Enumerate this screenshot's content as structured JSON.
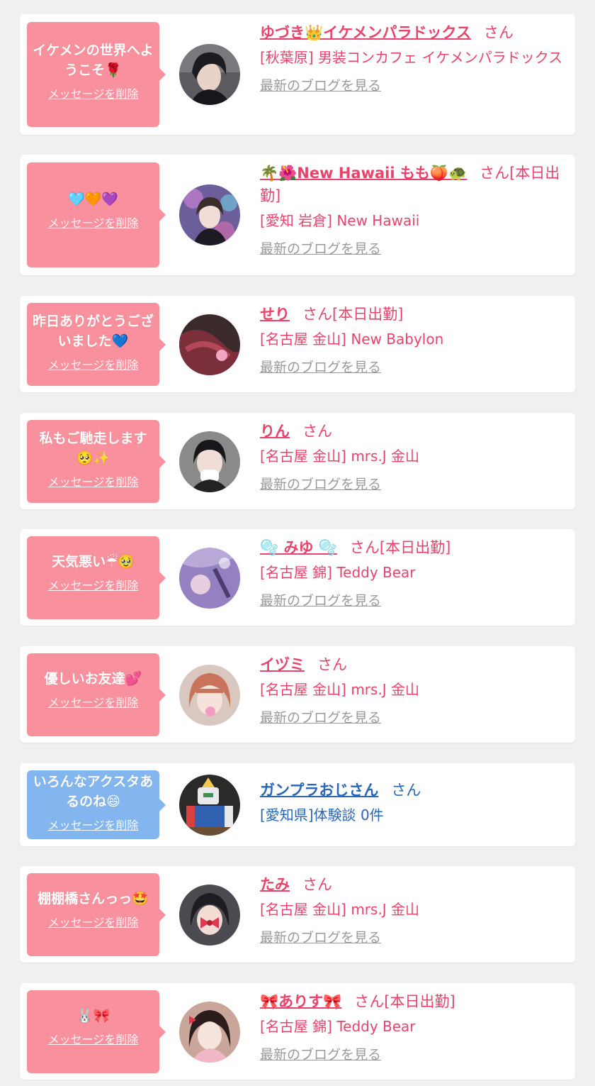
{
  "delete_label": "メッセージを削除",
  "blog_label": "最新のブログを見る",
  "colors": {
    "bubble_pink": "#f8909d",
    "bubble_blue": "#83b5ee",
    "name_pink": "#e8446b",
    "name_blue": "#2a66b8",
    "link_gray": "#9a9a9a"
  },
  "items": [
    {
      "message": "イケメンの世界へようこそ🌹",
      "name": "ゆづき👑イケメンパラドックス",
      "suffix": "さん",
      "shop": "[秋葉原] 男装コンカフェ イケメンパラドックス",
      "avatar": "dark-hair-portrait"
    },
    {
      "message": "🩵🧡💜",
      "name": "🌴🌺New Hawaii もも🍑🐢",
      "suffix": "さん[本日出勤]",
      "shop": "[愛知 岩倉] New Hawaii",
      "avatar": "neon-bg-portrait"
    },
    {
      "message": "昨日ありがとうございました💙",
      "name": "せり",
      "suffix": "さん[本日出勤]",
      "shop": "[名古屋 金山] New Babylon",
      "avatar": "red-hair-portrait"
    },
    {
      "message": "私もご馳走します🥺✨",
      "name": "りん",
      "suffix": "さん",
      "shop": "[名古屋 金山] mrs.J 金山",
      "avatar": "masked-portrait"
    },
    {
      "message": "天気悪い☔🥹",
      "name": "🫧 みゆ 🫧",
      "suffix": "さん[本日出勤]",
      "shop": "[名古屋 錦] Teddy Bear",
      "avatar": "purple-blur-portrait"
    },
    {
      "message": "優しいお友達💕",
      "name": "イヅミ",
      "suffix": "さん",
      "shop": "[名古屋 金山] mrs.J 金山",
      "avatar": "bangs-portrait"
    },
    {
      "message": "いろんなアクスタあるのね😄",
      "name": "ガンプラおじさん",
      "suffix": "さん",
      "shop": "[愛知県]体験談 0件",
      "avatar": "gundam-model"
    },
    {
      "message": "棚棚橋さんっっ🤩",
      "name": "たみ",
      "suffix": "さん",
      "shop": "[名古屋 金山] mrs.J 金山",
      "avatar": "bow-sticker-portrait"
    },
    {
      "message": "🐰🎀",
      "name": "🎀ありす🎀",
      "suffix": "さん[本日出勤]",
      "shop": "[名古屋 錦] Teddy Bear",
      "avatar": "ribbon-hair-portrait"
    }
  ]
}
